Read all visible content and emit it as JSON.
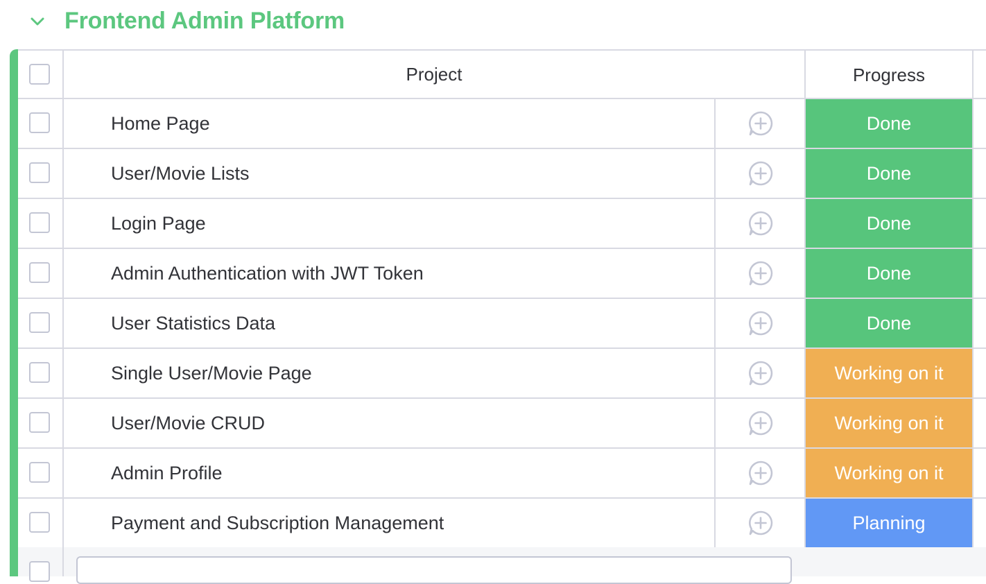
{
  "group": {
    "title": "Frontend Admin Platform",
    "color": "#5cc77f",
    "chevron_icon": "chevron-down-icon"
  },
  "table": {
    "headers": {
      "name": "Project",
      "status": "Progress"
    },
    "update_icon": "add-update-icon",
    "rows": [
      {
        "name": "Home Page",
        "status": "Done",
        "status_color": "#57c57c"
      },
      {
        "name": "User/Movie Lists",
        "status": "Done",
        "status_color": "#57c57c"
      },
      {
        "name": "Login Page",
        "status": "Done",
        "status_color": "#57c57c"
      },
      {
        "name": "Admin Authentication with JWT Token",
        "status": "Done",
        "status_color": "#57c57c"
      },
      {
        "name": "User Statistics Data",
        "status": "Done",
        "status_color": "#57c57c"
      },
      {
        "name": "Single User/Movie Page",
        "status": "Working on it",
        "status_color": "#f0af53"
      },
      {
        "name": "User/Movie CRUD",
        "status": "Working on it",
        "status_color": "#f0af53"
      },
      {
        "name": "Admin Profile",
        "status": "Working on it",
        "status_color": "#f0af53"
      },
      {
        "name": "Payment and Subscription Management",
        "status": "Planning",
        "status_color": "#6198f5"
      }
    ]
  },
  "colors": {
    "border": "#d8d9e2",
    "text": "#323338"
  }
}
